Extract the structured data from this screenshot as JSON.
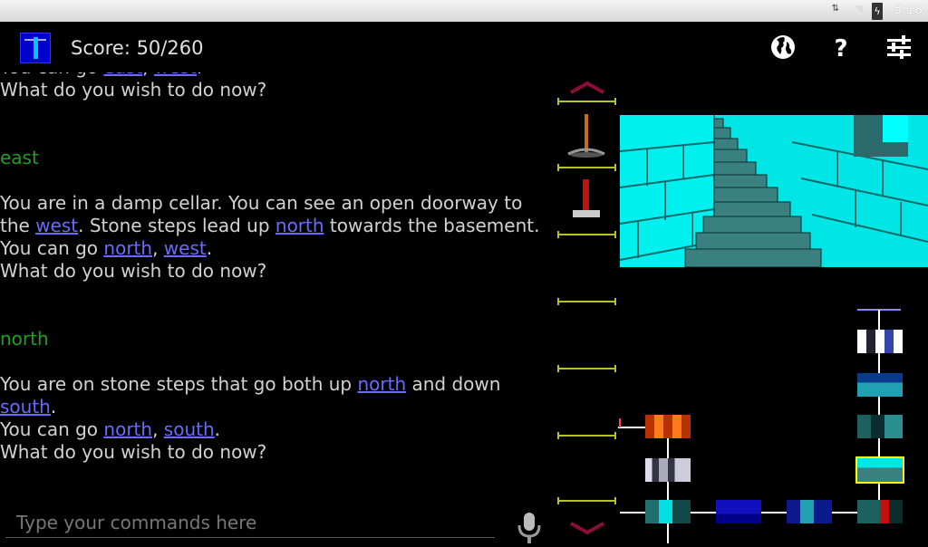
{
  "status_bar": {
    "time": "5:18",
    "signal_glyph": "⇅",
    "wifi_glyph": "◥"
  },
  "header": {
    "score": "Score: 50/260",
    "icons": [
      "lighthouse-app-icon",
      "globe-icon",
      "help-icon",
      "settings-icon"
    ],
    "help_label": "?"
  },
  "transcript": [
    {
      "type": "text",
      "parts": [
        {
          "t": "You can go "
        },
        {
          "t": "east",
          "link": true
        },
        {
          "t": ", "
        },
        {
          "t": "west",
          "link": true
        },
        {
          "t": "."
        }
      ]
    },
    {
      "type": "text",
      "parts": [
        {
          "t": "What do you wish to do now?"
        }
      ]
    },
    {
      "type": "blank"
    },
    {
      "type": "blank"
    },
    {
      "type": "command",
      "parts": [
        {
          "t": "east"
        }
      ]
    },
    {
      "type": "blank"
    },
    {
      "type": "text",
      "parts": [
        {
          "t": "You are in a damp cellar. You can see an open doorway to"
        }
      ]
    },
    {
      "type": "text",
      "parts": [
        {
          "t": "the "
        },
        {
          "t": "west",
          "link": true
        },
        {
          "t": ". Stone steps lead up "
        },
        {
          "t": "north",
          "link": true
        },
        {
          "t": " towards the basement."
        }
      ]
    },
    {
      "type": "text",
      "parts": [
        {
          "t": "You can go "
        },
        {
          "t": "north",
          "link": true
        },
        {
          "t": ", "
        },
        {
          "t": "west",
          "link": true
        },
        {
          "t": "."
        }
      ]
    },
    {
      "type": "text",
      "parts": [
        {
          "t": "What do you wish to do now?"
        }
      ]
    },
    {
      "type": "blank"
    },
    {
      "type": "blank"
    },
    {
      "type": "command",
      "parts": [
        {
          "t": "north"
        }
      ]
    },
    {
      "type": "blank"
    },
    {
      "type": "text",
      "parts": [
        {
          "t": "You are on stone steps that go both up "
        },
        {
          "t": "north",
          "link": true
        },
        {
          "t": " and down"
        }
      ]
    },
    {
      "type": "text",
      "parts": [
        {
          "t": "south",
          "link": true
        },
        {
          "t": "."
        }
      ]
    },
    {
      "type": "text",
      "parts": [
        {
          "t": "You can go "
        },
        {
          "t": "north",
          "link": true
        },
        {
          "t": ", "
        },
        {
          "t": "south",
          "link": true
        },
        {
          "t": "."
        }
      ]
    },
    {
      "type": "text",
      "parts": [
        {
          "t": "What do you wish to do now?"
        }
      ]
    }
  ],
  "input": {
    "placeholder": "Type your commands here",
    "value": ""
  },
  "inventory": {
    "items": [
      "pickaxe",
      "red-post"
    ],
    "shelf_count": 7
  },
  "colors": {
    "link": "#6a6aff",
    "command": "#1fa11f",
    "shelf": "#b7c31f",
    "map_line": "#ffffff",
    "current_room_border": "#ffff00"
  },
  "map": {
    "rooms": [
      {
        "name": "room-stairs-top",
        "col": 3,
        "row": 1,
        "palette": "white-blue"
      },
      {
        "name": "room-teal-corridor",
        "col": 3,
        "row": 2,
        "palette": "teal"
      },
      {
        "name": "room-teal-door",
        "col": 3,
        "row": 3,
        "palette": "teal-dark"
      },
      {
        "name": "room-stone-steps",
        "col": 3,
        "row": 4,
        "palette": "cyan",
        "current": true
      },
      {
        "name": "room-orange-cave",
        "col": 0,
        "row": 3,
        "palette": "orange"
      },
      {
        "name": "room-grey-pillars",
        "col": 0,
        "row": 4,
        "palette": "grey"
      },
      {
        "name": "room-cyan-hall",
        "col": 0,
        "row": 5,
        "palette": "cyan"
      },
      {
        "name": "room-blue-room",
        "col": 1,
        "row": 5,
        "palette": "blue"
      },
      {
        "name": "room-blue-corridor",
        "col": 2,
        "row": 5,
        "palette": "blue-teal"
      },
      {
        "name": "room-red-cellar",
        "col": 3,
        "row": 5,
        "palette": "teal-red"
      }
    ]
  }
}
